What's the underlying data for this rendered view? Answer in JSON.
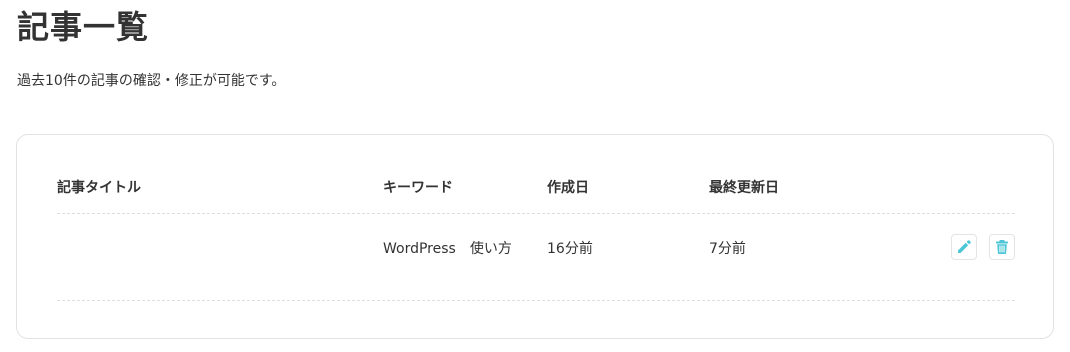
{
  "page": {
    "title": "記事一覧",
    "description": "過去10件の記事の確認・修正が可能です。"
  },
  "table": {
    "headers": {
      "title": "記事タイトル",
      "keyword": "キーワード",
      "created": "作成日",
      "updated": "最終更新日"
    },
    "rows": [
      {
        "title": "",
        "keyword": "WordPress　使い方",
        "created": "16分前",
        "updated": "7分前",
        "edit_icon": "pencil-icon",
        "delete_icon": "trash-icon"
      }
    ]
  },
  "colors": {
    "icon_accent": "#4cc6d6",
    "text": "#333333",
    "border": "#e2e2e2"
  }
}
